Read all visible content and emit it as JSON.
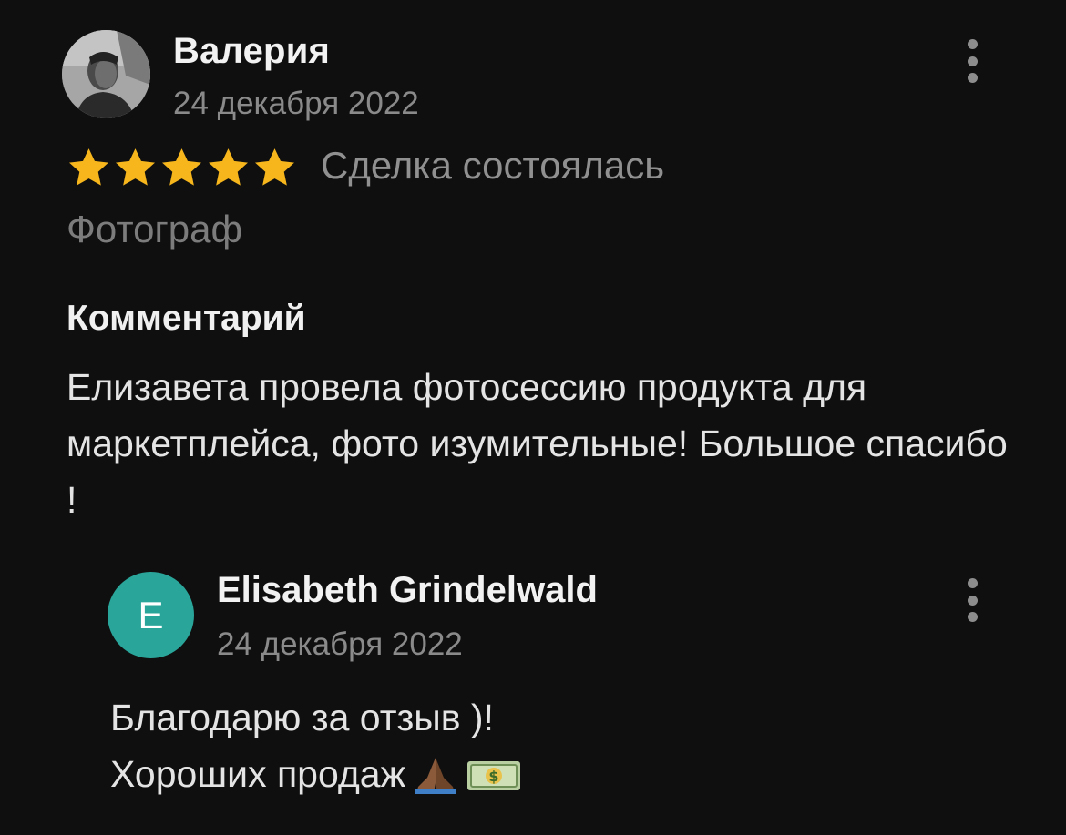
{
  "review": {
    "author": "Валерия",
    "date": "24 декабря 2022",
    "rating": 5,
    "rating_max": 5,
    "deal_status": "Сделка состоялась",
    "category": "Фотограф",
    "comment_heading": "Комментарий",
    "comment_text": "Елизавета провела фотосессию продукта для маркетплейса, фото изумительные! Большое спасибо !",
    "menu_icon": "more-vertical-icon",
    "avatar_icon": "user-photo-avatar"
  },
  "reply": {
    "avatar_letter": "E",
    "avatar_color": "#2aa59a",
    "author": "Elisabeth Grindelwald",
    "date": "24 декабря 2022",
    "line1": "Благодарю за отзыв )!",
    "line2": "Хороших продаж",
    "emojis": [
      "folded-hands-icon",
      "dollar-banknote-icon"
    ],
    "menu_icon": "more-vertical-icon"
  },
  "colors": {
    "background": "#0f0f0f",
    "star": "#f6b61c",
    "muted_text": "#8a8a8a"
  }
}
